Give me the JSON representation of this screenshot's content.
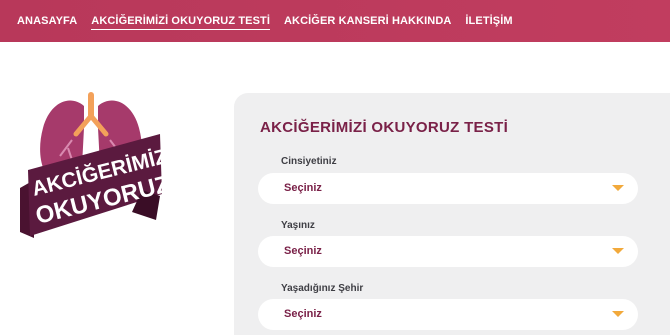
{
  "nav": {
    "items": [
      {
        "label": "ANASAYFA"
      },
      {
        "label": "AKCİĞERİMİZİ OKUYORUZ TESTİ",
        "active": true
      },
      {
        "label": "AKCİĞER KANSERİ HAKKINDA"
      },
      {
        "label": "İLETİŞİM"
      }
    ]
  },
  "logo": {
    "line1": "AKCİĞERİMİZİ",
    "line2": "OKUYORUZ"
  },
  "form": {
    "title": "AKCİĞERİMİZİ OKUYORUZ TESTİ",
    "fields": [
      {
        "label": "Cinsiyetiniz",
        "value": "Seçiniz"
      },
      {
        "label": "Yaşınız",
        "value": "Seçiniz"
      },
      {
        "label": "Yaşadığınız Şehir",
        "value": "Seçiniz"
      }
    ]
  },
  "colors": {
    "brand": "#c13d5f",
    "title": "#7a2148",
    "caret": "#f2a93b",
    "panel": "#efeff0"
  }
}
